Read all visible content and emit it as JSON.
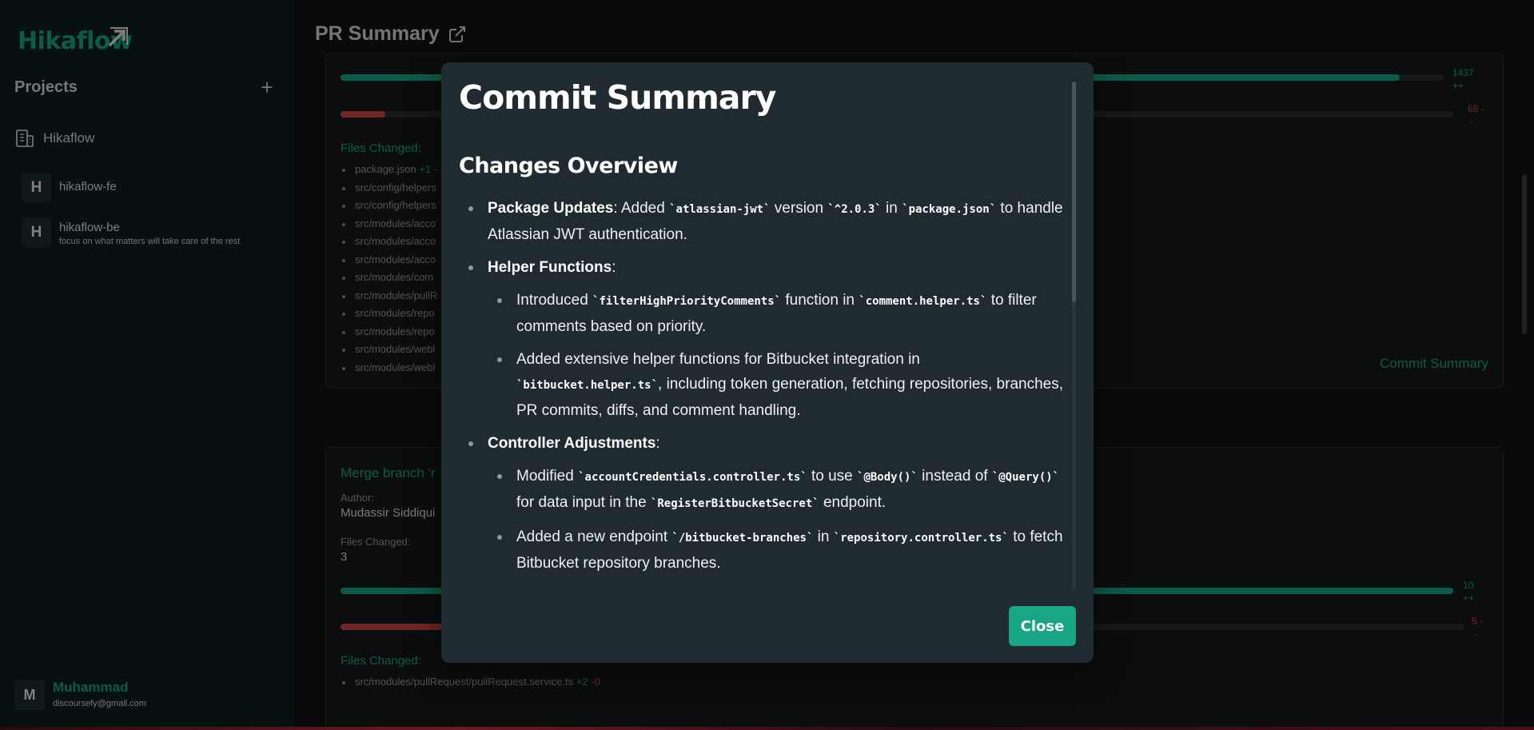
{
  "sidebar": {
    "logo": "Hikaflow",
    "projects_title": "Projects",
    "workspace": "Hikaflow",
    "items": [
      {
        "initial": "H",
        "name": "hikaflow-fe",
        "subtitle": ""
      },
      {
        "initial": "H",
        "name": "hikaflow-be",
        "subtitle": "focus on what matters will take care of the rest"
      }
    ],
    "user": {
      "initial": "M",
      "name": "Muhammad",
      "email": "discoursefy@gmail.com"
    }
  },
  "header": {
    "title": "PR Summary"
  },
  "card1": {
    "additions": "1437",
    "additions_suffix": "++",
    "deletions": "68 -",
    "deletions_suffix": "-",
    "additions_ratio": 0.96,
    "deletions_ratio": 0.04,
    "files_label": "Files Changed:",
    "files": [
      {
        "name": "package.json",
        "add": "+1",
        "del": "-"
      },
      {
        "name": "src/config/helpers",
        "add": "",
        "del": ""
      },
      {
        "name": "src/config/helpers",
        "add": "",
        "del": ""
      },
      {
        "name": "src/modules/acco",
        "add": "",
        "del": ""
      },
      {
        "name": "src/modules/acco",
        "add": "",
        "del": ""
      },
      {
        "name": "src/modules/acco",
        "add": "",
        "del": ""
      },
      {
        "name": "src/modules/com",
        "add": "",
        "del": ""
      },
      {
        "name": "src/modules/pullR",
        "add": "",
        "del": ""
      },
      {
        "name": "src/modules/repo",
        "add": "",
        "del": ""
      },
      {
        "name": "src/modules/repo",
        "add": "",
        "del": ""
      },
      {
        "name": "src/modules/webl",
        "add": "",
        "del": ""
      },
      {
        "name": "src/modules/webl",
        "add": "",
        "del": ""
      }
    ],
    "commit_link": "Commit Summary"
  },
  "card2": {
    "title": "Merge branch 'r",
    "author_label": "Author:",
    "author": "Mudassir Siddiqui",
    "files_changed_label": "Files Changed:",
    "files_changed": "3",
    "additions": "10",
    "additions_suffix": "++",
    "deletions": "5 -",
    "deletions_suffix": "-",
    "additions_ratio": 1.0,
    "deletions_ratio": 0.5,
    "files_label": "Files Changed:",
    "files": [
      {
        "name": "src/modules/pullRequest/pullRequest.service.ts",
        "add": "+2",
        "del": "-0"
      }
    ]
  },
  "modal": {
    "title": "Commit Summary",
    "section": "Changes Overview",
    "close_label": "Close"
  },
  "colors": {
    "accent": "#17a585",
    "danger": "#d24545",
    "modal_bg": "#1f2b30",
    "sidebar_bg": "#0f1f20"
  }
}
